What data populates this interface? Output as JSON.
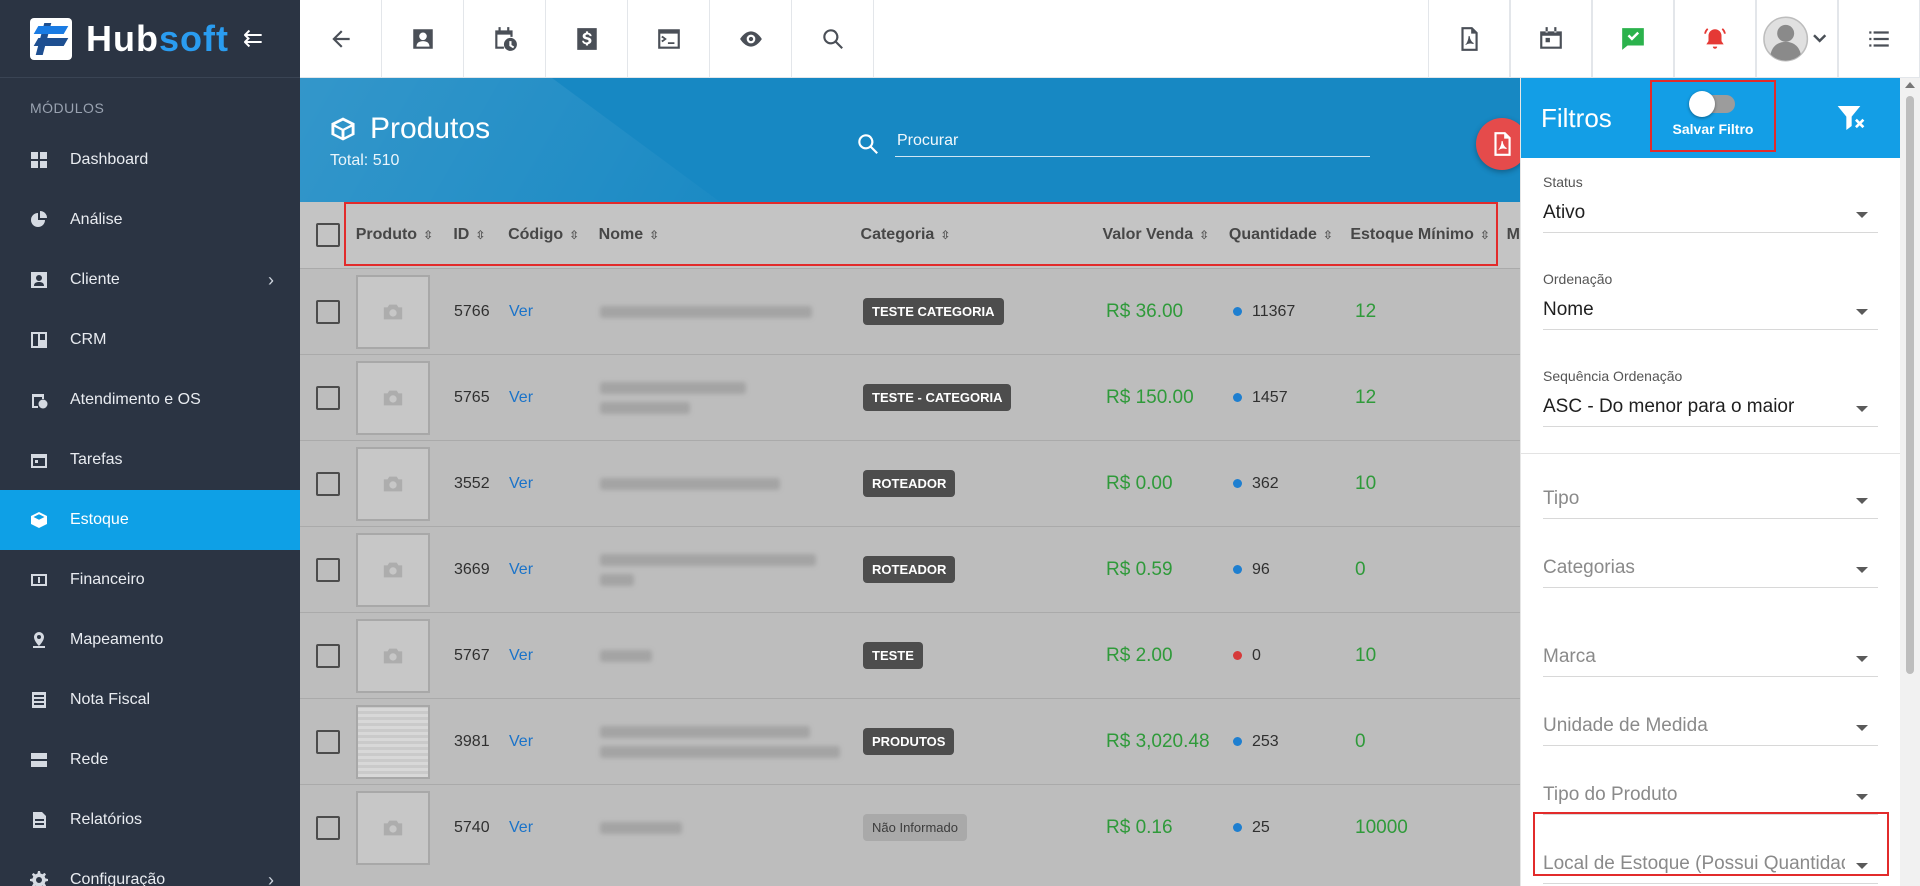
{
  "brand": {
    "name_a": "Hub",
    "name_b": "soft"
  },
  "sidebar": {
    "section_label": "MÓDULOS",
    "items": [
      {
        "label": "Dashboard",
        "icon": "dashboard-icon"
      },
      {
        "label": "Análise",
        "icon": "pie-chart-icon"
      },
      {
        "label": "Cliente",
        "icon": "contact-card-icon"
      },
      {
        "label": "CRM",
        "icon": "board-icon"
      },
      {
        "label": "Atendimento e OS",
        "icon": "calendar-clock-icon"
      },
      {
        "label": "Tarefas",
        "icon": "tasks-icon"
      },
      {
        "label": "Estoque",
        "icon": "box-icon"
      },
      {
        "label": "Financeiro",
        "icon": "money-icon"
      },
      {
        "label": "Mapeamento",
        "icon": "map-pin-icon"
      },
      {
        "label": "Nota Fiscal",
        "icon": "invoice-icon"
      },
      {
        "label": "Rede",
        "icon": "server-icon"
      },
      {
        "label": "Relatórios",
        "icon": "report-icon"
      },
      {
        "label": "Configuração",
        "icon": "gear-icon"
      }
    ],
    "active": "Estoque"
  },
  "page": {
    "title": "Produtos",
    "total": "Total: 510",
    "search_placeholder": "Procurar"
  },
  "table": {
    "headers": [
      "Produto",
      "ID",
      "Código",
      "Nome",
      "Categoria",
      "Valor Venda",
      "Quantidade",
      "Estoque Mínimo",
      "M"
    ],
    "rows": [
      {
        "id": "5766",
        "code": "Ver",
        "category": "TESTE CATEGORIA",
        "price": "R$ 36.00",
        "qty": "11367",
        "qty_status": "blue",
        "min": "12"
      },
      {
        "id": "5765",
        "code": "Ver",
        "category": "TESTE - CATEGORIA",
        "price": "R$ 150.00",
        "qty": "1457",
        "qty_status": "blue",
        "min": "12"
      },
      {
        "id": "3552",
        "code": "Ver",
        "category": "ROTEADOR",
        "price": "R$ 0.00",
        "qty": "362",
        "qty_status": "blue",
        "min": "10"
      },
      {
        "id": "3669",
        "code": "Ver",
        "category": "ROTEADOR",
        "price": "R$ 0.59",
        "qty": "96",
        "qty_status": "blue",
        "min": "0"
      },
      {
        "id": "5767",
        "code": "Ver",
        "category": "TESTE",
        "price": "R$ 2.00",
        "qty": "0",
        "qty_status": "red",
        "min": "10"
      },
      {
        "id": "3981",
        "code": "Ver",
        "category": "PRODUTOS",
        "price": "R$ 3,020.48",
        "qty": "253",
        "qty_status": "blue",
        "min": "0"
      },
      {
        "id": "5740",
        "code": "Ver",
        "category": "Não Informado",
        "price": "R$ 0.16",
        "qty": "25",
        "qty_status": "blue",
        "min": "10000"
      }
    ]
  },
  "filters": {
    "title": "Filtros",
    "save_label": "Salvar Filtro",
    "status": {
      "label": "Status",
      "value": "Ativo"
    },
    "ordenacao": {
      "label": "Ordenação",
      "value": "Nome"
    },
    "sequencia": {
      "label": "Sequência Ordenação",
      "value": "ASC - Do menor para o maior"
    },
    "tipo": "Tipo",
    "categorias": "Categorias",
    "marca": "Marca",
    "unidade": "Unidade de Medida",
    "tipo_produto": "Tipo do Produto",
    "local": "Local de Estoque (Possui Quantidade)"
  },
  "colors": {
    "accent": "#0ea0e6",
    "sidebar": "#2b3443",
    "price": "#2f9a3a",
    "highlight": "#e22b2b"
  }
}
